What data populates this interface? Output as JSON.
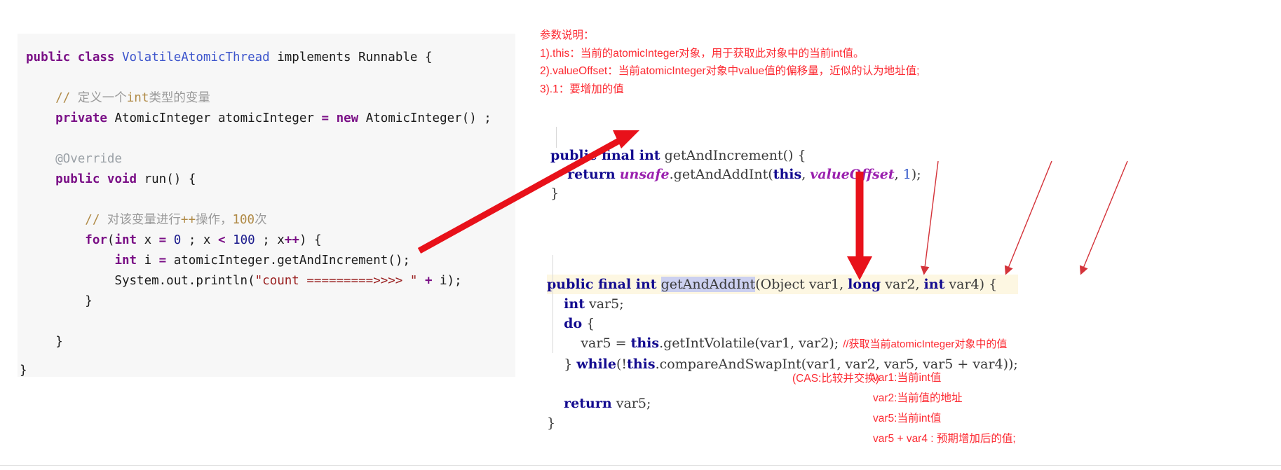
{
  "left_code": {
    "lines": [
      [
        {
          "t": "public ",
          "c": "kw"
        },
        {
          "t": "class ",
          "c": "kw"
        },
        {
          "t": "VolatileAtomicThread",
          "c": "type"
        },
        {
          "t": " implements ",
          "c": "plain"
        },
        {
          "t": "Runnable",
          "c": "plain"
        },
        {
          "t": " {",
          "c": "plain"
        }
      ],
      [
        {
          "t": "",
          "c": "plain"
        }
      ],
      [
        {
          "t": "    // ",
          "c": "cmt"
        },
        {
          "t": "定义一个",
          "c": "cmt-cn"
        },
        {
          "t": "int",
          "c": "cmt"
        },
        {
          "t": "类型的变量",
          "c": "cmt-cn"
        }
      ],
      [
        {
          "t": "    ",
          "c": "plain"
        },
        {
          "t": "private ",
          "c": "kw"
        },
        {
          "t": "AtomicInteger",
          "c": "plain"
        },
        {
          "t": " atomicInteger ",
          "c": "plain"
        },
        {
          "t": "=",
          "c": "kw"
        },
        {
          "t": " ",
          "c": "plain"
        },
        {
          "t": "new ",
          "c": "kw"
        },
        {
          "t": "AtomicInteger",
          "c": "plain"
        },
        {
          "t": "() ;",
          "c": "plain"
        }
      ],
      [
        {
          "t": "",
          "c": "plain"
        }
      ],
      [
        {
          "t": "    @Override",
          "c": "ann"
        }
      ],
      [
        {
          "t": "    ",
          "c": "plain"
        },
        {
          "t": "public ",
          "c": "kw"
        },
        {
          "t": "void",
          "c": "kw"
        },
        {
          "t": " run() {",
          "c": "plain"
        }
      ],
      [
        {
          "t": "",
          "c": "plain"
        }
      ],
      [
        {
          "t": "        // ",
          "c": "cmt"
        },
        {
          "t": "对该变量进行",
          "c": "cmt-cn"
        },
        {
          "t": "++",
          "c": "cmt"
        },
        {
          "t": "操作，",
          "c": "cmt-cn"
        },
        {
          "t": "100",
          "c": "cmt"
        },
        {
          "t": "次",
          "c": "cmt-cn"
        }
      ],
      [
        {
          "t": "        ",
          "c": "plain"
        },
        {
          "t": "for",
          "c": "kw"
        },
        {
          "t": "(",
          "c": "plain"
        },
        {
          "t": "int",
          "c": "kw"
        },
        {
          "t": " x ",
          "c": "plain"
        },
        {
          "t": "=",
          "c": "kw"
        },
        {
          "t": " ",
          "c": "plain"
        },
        {
          "t": "0",
          "c": "num"
        },
        {
          "t": " ; x ",
          "c": "plain"
        },
        {
          "t": "<",
          "c": "kw"
        },
        {
          "t": " ",
          "c": "plain"
        },
        {
          "t": "100",
          "c": "num"
        },
        {
          "t": " ; x",
          "c": "plain"
        },
        {
          "t": "++",
          "c": "kw"
        },
        {
          "t": ") {",
          "c": "plain"
        }
      ],
      [
        {
          "t": "            ",
          "c": "plain"
        },
        {
          "t": "int",
          "c": "kw"
        },
        {
          "t": " i ",
          "c": "plain"
        },
        {
          "t": "=",
          "c": "kw"
        },
        {
          "t": " atomicInteger.getAndIncrement();",
          "c": "plain"
        }
      ],
      [
        {
          "t": "            System.out.println(",
          "c": "plain"
        },
        {
          "t": "\"count =========>>>> \"",
          "c": "str"
        },
        {
          "t": " ",
          "c": "plain"
        },
        {
          "t": "+",
          "c": "kw"
        },
        {
          "t": " i);",
          "c": "plain"
        }
      ],
      [
        {
          "t": "        }",
          "c": "plain"
        }
      ],
      [
        {
          "t": "",
          "c": "plain"
        }
      ],
      [
        {
          "t": "    }",
          "c": "plain"
        }
      ]
    ],
    "class_close_brace": "}"
  },
  "params_note": {
    "title": "参数说明：",
    "items": [
      "1).this：当前的atomicInteger对象，用于获取此对象中的当前int值。",
      "2).valueOffset：当前atomicInteger对象中value值的偏移量，近似的认为地址值;",
      "3).1：要增加的值"
    ]
  },
  "get_and_increment": {
    "lines": [
      [
        {
          "t": "public final int",
          "c": "k2"
        },
        {
          "t": " getAndIncrement() {",
          "c": "id2"
        }
      ],
      [
        {
          "t": "    ",
          "c": "p2"
        },
        {
          "t": "return",
          "c": "k2"
        },
        {
          "t": " ",
          "c": "p2"
        },
        {
          "t": "unsafe",
          "c": "it2"
        },
        {
          "t": ".getAndAddInt(",
          "c": "id2"
        },
        {
          "t": "this",
          "c": "k2"
        },
        {
          "t": ", ",
          "c": "id2"
        },
        {
          "t": "valueOffset",
          "c": "it2"
        },
        {
          "t": ", ",
          "c": "id2"
        },
        {
          "t": "1",
          "c": "n2"
        },
        {
          "t": ");",
          "c": "id2"
        }
      ],
      [
        {
          "t": "}",
          "c": "id2"
        }
      ]
    ]
  },
  "get_and_add_int": {
    "signature": {
      "kw": "public final int",
      "space": " ",
      "name": "getAndAddInt",
      "open_paren": "(",
      "arg1_type": "Object",
      "arg1": " var1, ",
      "arg2_type": "long",
      "arg2": " var2, ",
      "arg3_type": "int",
      "arg3": " var4) {"
    },
    "body": [
      [
        {
          "t": "    ",
          "c": "p2"
        },
        {
          "t": "int",
          "c": "k2"
        },
        {
          "t": " var5;",
          "c": "id2"
        }
      ],
      [
        {
          "t": "    ",
          "c": "p2"
        },
        {
          "t": "do",
          "c": "k2"
        },
        {
          "t": " {",
          "c": "id2"
        }
      ],
      [
        {
          "t": "        var5 = ",
          "c": "id2"
        },
        {
          "t": "this",
          "c": "k2"
        },
        {
          "t": ".getIntVolatile(var1, var2); ",
          "c": "id2"
        },
        {
          "t": "//获取当前atomicInteger对象中的值",
          "c": "cn2"
        }
      ],
      [
        {
          "t": "    } ",
          "c": "id2"
        },
        {
          "t": "while",
          "c": "k2"
        },
        {
          "t": "(!",
          "c": "id2"
        },
        {
          "t": "this",
          "c": "k2"
        },
        {
          "t": ".compareAndSwapInt(var1, var2, var5, var5 + var4));",
          "c": "id2"
        }
      ],
      [
        {
          "t": "",
          "c": "p2"
        }
      ],
      [
        {
          "t": "    ",
          "c": "p2"
        },
        {
          "t": "return",
          "c": "k2"
        },
        {
          "t": " var5;",
          "c": "id2"
        }
      ],
      [
        {
          "t": "}",
          "c": "id2"
        }
      ]
    ]
  },
  "cas_note": "(CAS:比较并交换)",
  "var_notes": [
    "var1:当前int值",
    "var2:当前值的地址",
    "var5:当前int值",
    "var5 + var4 : 预期增加后的值;"
  ],
  "colors": {
    "annotation_red": "#fc2a32",
    "arrow_red": "#e8111a",
    "thin_arrow_red": "#d4333a",
    "code_bg": "#f7f7f7",
    "signature_highlight": "#fdf7e2",
    "name_highlight": "#ccd0f0",
    "keyword_navy": "#120a8f",
    "italic_purple": "#9a1fae"
  },
  "icons": {
    "big_arrow_diagonal": "arrow-up-right-icon",
    "big_arrow_down": "arrow-down-icon",
    "thin_pointer": "thin-arrow-icon"
  }
}
